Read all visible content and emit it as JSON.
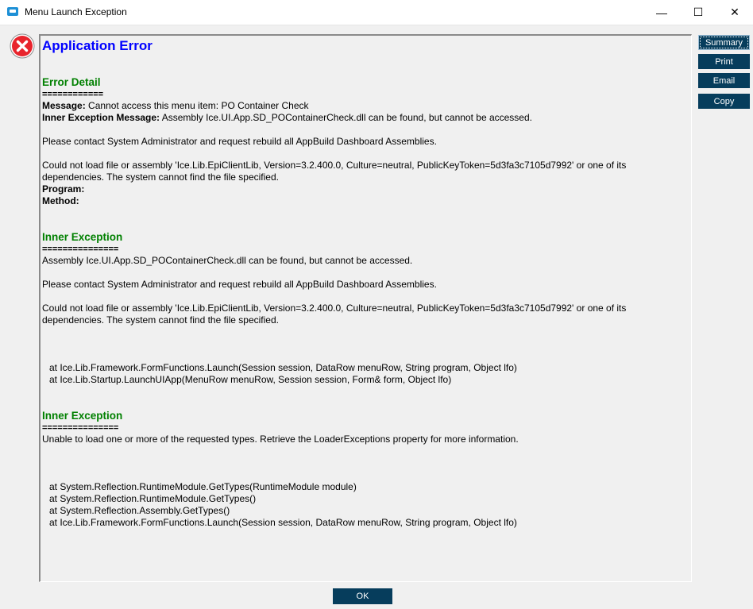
{
  "window": {
    "title": "Menu Launch Exception",
    "minimize_glyph": "—",
    "maximize_glyph": "☐",
    "close_glyph": "✕"
  },
  "colors": {
    "heading_blue": "#0000ff",
    "section_green": "#008000",
    "button_navy": "#063d5c",
    "error_red": "#e8242c"
  },
  "icons": {
    "error": "error-circle-x-icon"
  },
  "buttons": {
    "summary": "Summary",
    "print": "Print",
    "email": "Email",
    "copy": "Copy",
    "ok": "OK"
  },
  "error": {
    "heading": "Application Error",
    "detail": {
      "title": "Error Detail",
      "separator": "============",
      "message_label": "Message:",
      "message": " Cannot access this menu item: PO Container Check",
      "inner_label": "Inner Exception Message:",
      "inner_message": " Assembly Ice.UI.App.SD_POContainerCheck.dll can be found, but cannot be accessed.",
      "contact": "Please contact System Administrator and request rebuild all AppBuild Dashboard Assemblies.",
      "could_not_load_1": "Could not load file or assembly 'Ice.Lib.EpiClientLib, Version=3.2.400.0, Culture=neutral, PublicKeyToken=5d3fa3c7105d7992' or one of its",
      "could_not_load_2": "dependencies. The system cannot find the file specified.",
      "program_label": "Program:",
      "method_label": "Method:"
    },
    "inner1": {
      "title": "Inner Exception",
      "separator": "===============",
      "message": "Assembly Ice.UI.App.SD_POContainerCheck.dll can be found, but cannot be accessed.",
      "contact": "Please contact System Administrator and request rebuild all AppBuild Dashboard Assemblies.",
      "could_not_load_1": "Could not load file or assembly 'Ice.Lib.EpiClientLib, Version=3.2.400.0, Culture=neutral, PublicKeyToken=5d3fa3c7105d7992' or one of its",
      "could_not_load_2": "dependencies. The system cannot find the file specified.",
      "stack": [
        "at Ice.Lib.Framework.FormFunctions.Launch(Session session, DataRow menuRow, String program, Object lfo)",
        "at Ice.Lib.Startup.LaunchUIApp(MenuRow menuRow, Session session, Form& form, Object lfo)"
      ]
    },
    "inner2": {
      "title": "Inner Exception",
      "separator": "===============",
      "message": "Unable to load one or more of the requested types. Retrieve the LoaderExceptions property for more information.",
      "stack": [
        "at System.Reflection.RuntimeModule.GetTypes(RuntimeModule module)",
        "at System.Reflection.RuntimeModule.GetTypes()",
        "at System.Reflection.Assembly.GetTypes()",
        "at Ice.Lib.Framework.FormFunctions.Launch(Session session, DataRow menuRow, String program, Object lfo)"
      ]
    }
  }
}
